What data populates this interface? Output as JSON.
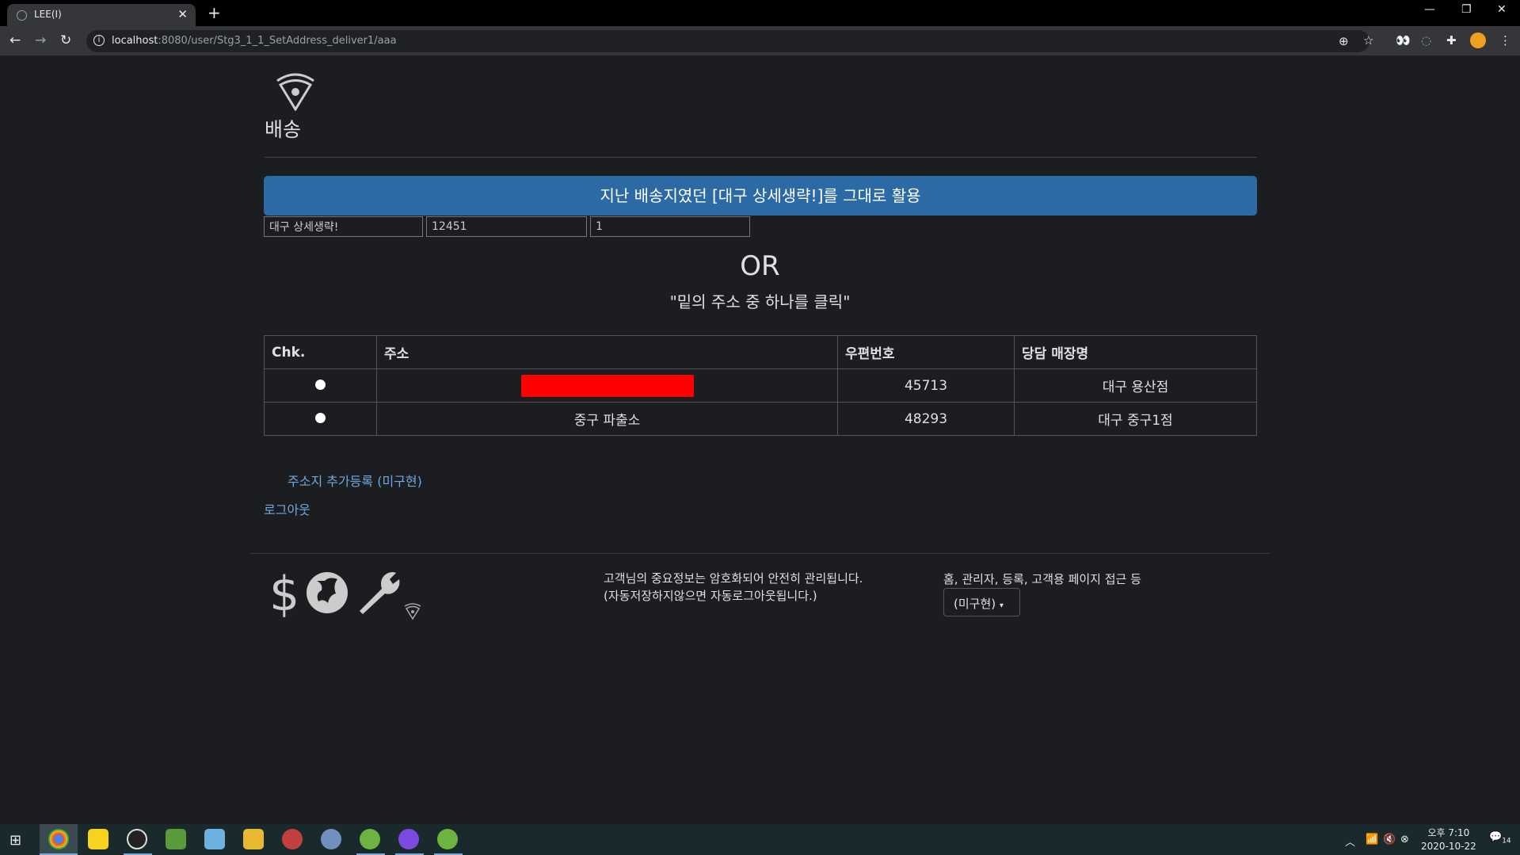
{
  "browser": {
    "tab_title": "LEE(I)",
    "url_host": "localhost",
    "url_rest": ":8080/user/Stg3_1_1_SetAddress_deliver1/aaa"
  },
  "page": {
    "title": "배송",
    "reuse_button": "지난 배송지였던 [대구 상세생략!]를 그대로 활용",
    "inputs": {
      "address": "대구 상세생략!",
      "zipcode": "12451",
      "extra": "1"
    },
    "or_text": "OR",
    "hint_text": "\"밑의 주소 중 하나를 클릭\"",
    "table": {
      "headers": [
        "Chk.",
        "주소",
        "우편번호",
        "당담 매장명"
      ],
      "rows": [
        {
          "address": "",
          "zipcode": "45713",
          "store": "대구 용산점"
        },
        {
          "address": "중구 파출소",
          "zipcode": "48293",
          "store": "대구 중구1점"
        }
      ]
    },
    "add_address_link": "주소지 추가등록 (미구현)",
    "logout_link": "로그아웃"
  },
  "footer": {
    "note_line1": "고객님의 중요정보는 암호화되어 안전히 관리됩니다.",
    "note_line2": "(자동저장하지않으면 자동로그아웃됩니다.)",
    "menu_hint": "홈, 관리자, 등록, 고객용 페이지 접근 등",
    "dropdown_label": "(미구현)"
  },
  "taskbar": {
    "time": "오후 7:10",
    "date": "2020-10-22",
    "notif_count": "14"
  },
  "colors": {
    "accent": "#2c6aa5",
    "link": "#6ea8dc",
    "redaction": "#ff0000"
  }
}
